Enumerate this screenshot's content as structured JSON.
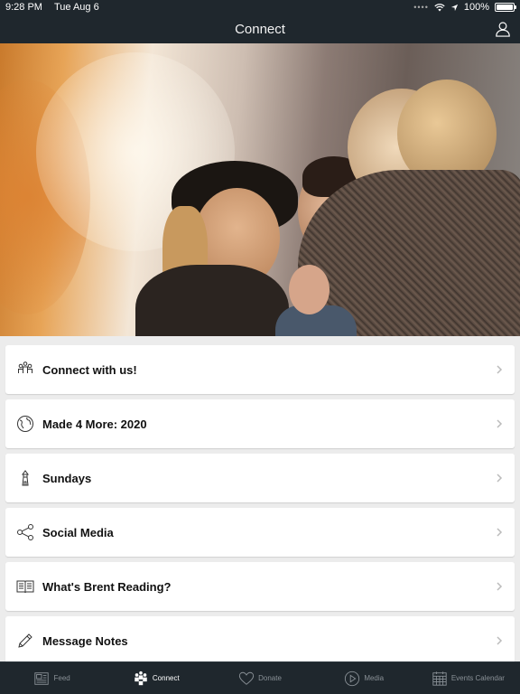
{
  "status": {
    "time": "9:28 PM",
    "date": "Tue Aug 6",
    "battery": "100%"
  },
  "header": {
    "title": "Connect"
  },
  "hero": {
    "description": "Photo of three smiling young women"
  },
  "menu": [
    {
      "label": "Connect with us!",
      "icon": "people-icon"
    },
    {
      "label": "Made 4 More: 2020",
      "icon": "globe-icon"
    },
    {
      "label": "Sundays",
      "icon": "lighthouse-icon"
    },
    {
      "label": "Social Media",
      "icon": "share-icon"
    },
    {
      "label": "What's Brent Reading?",
      "icon": "book-icon"
    },
    {
      "label": "Message Notes",
      "icon": "pencil-icon"
    }
  ],
  "tabs": [
    {
      "label": "Feed",
      "icon": "feed-icon",
      "active": false
    },
    {
      "label": "Connect",
      "icon": "people-icon",
      "active": true
    },
    {
      "label": "Donate",
      "icon": "heart-icon",
      "active": false
    },
    {
      "label": "Media",
      "icon": "play-icon",
      "active": false
    },
    {
      "label": "Events Calendar",
      "icon": "calendar-icon",
      "active": false
    }
  ],
  "colors": {
    "bar": "#1f272d",
    "background": "#ececec",
    "active_tab": "#ffffff",
    "inactive_tab": "#8a9197"
  }
}
